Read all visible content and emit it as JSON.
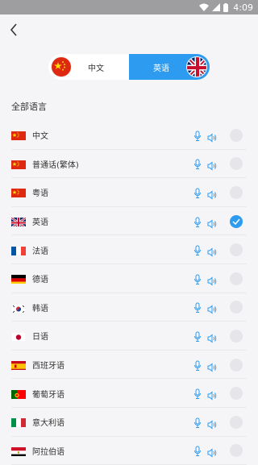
{
  "status": {
    "time": "4:09"
  },
  "switcher": {
    "left_label": "中文",
    "right_label": "英语"
  },
  "section_title": "全部语言",
  "languages": [
    {
      "name": "中文",
      "flag": "cn",
      "selected": false
    },
    {
      "name": "普通话(繁体)",
      "flag": "cn",
      "selected": false
    },
    {
      "name": "粤语",
      "flag": "cn",
      "selected": false
    },
    {
      "name": "英语",
      "flag": "uk",
      "selected": true
    },
    {
      "name": "法语",
      "flag": "fr",
      "selected": false
    },
    {
      "name": "德语",
      "flag": "de",
      "selected": false
    },
    {
      "name": "韩语",
      "flag": "kr",
      "selected": false
    },
    {
      "name": "日语",
      "flag": "jp",
      "selected": false
    },
    {
      "name": "西班牙语",
      "flag": "es",
      "selected": false
    },
    {
      "name": "葡萄牙语",
      "flag": "pt",
      "selected": false
    },
    {
      "name": "意大利语",
      "flag": "it",
      "selected": false
    },
    {
      "name": "阿拉伯语",
      "flag": "eg",
      "selected": false
    }
  ],
  "colors": {
    "accent": "#2d9cf0",
    "statusbar": "#9e9ea0",
    "background": "#f5f5f7"
  }
}
